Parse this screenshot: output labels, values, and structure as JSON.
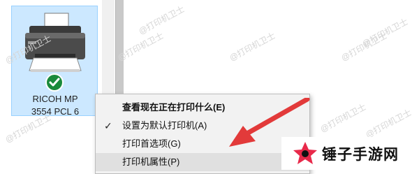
{
  "printer": {
    "name_line1": "RICOH MP",
    "name_line2": "3554 PCL 6",
    "status": "default-printer"
  },
  "context_menu": {
    "items": [
      {
        "label": "查看现在正在打印什么(E)",
        "bold": true,
        "checked": false
      },
      {
        "label": "设置为默认打印机(A)",
        "bold": false,
        "checked": true
      },
      {
        "label": "打印首选项(G)",
        "bold": false,
        "checked": false
      },
      {
        "label": "打印机属性(P)",
        "bold": false,
        "checked": false
      }
    ]
  },
  "watermark": {
    "text": "@打印机卫士"
  },
  "brand": {
    "name": "锤子手游网"
  },
  "colors": {
    "selection_bg": "#cce8ff",
    "check_green": "#1a8a3b",
    "arrow_red": "#e23a3a",
    "menu_bg": "#f2f2f2"
  }
}
